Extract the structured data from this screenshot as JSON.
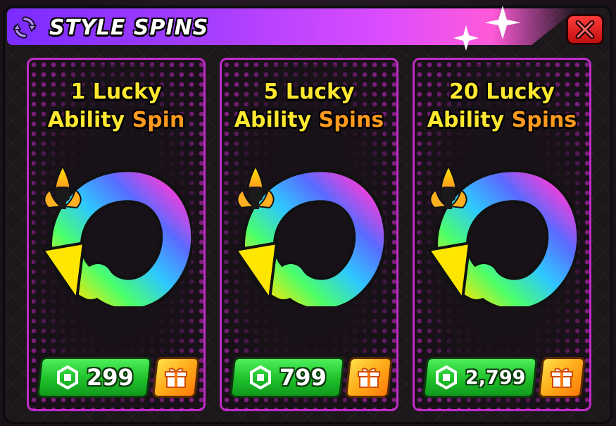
{
  "header": {
    "title": "STYLE SPINS",
    "refresh_icon": "refresh-icon",
    "close_icon": "close-icon"
  },
  "colors": {
    "header_start": "#7b2cff",
    "header_end": "#ff5ad8",
    "card_border": "#c02cc8",
    "price_green": "#1fbf2a",
    "gift_orange": "#ffab1a",
    "title_yellow": "#ffe830",
    "title_orange": "#ff9a1e",
    "close_red": "#d41515"
  },
  "cards": [
    {
      "line1": "1 Lucky",
      "line2_a": "Ability ",
      "line2_b": "Spin",
      "price": "299",
      "currency_icon": "robux-icon",
      "gift_icon": "gift-icon"
    },
    {
      "line1": "5 Lucky",
      "line2_a": "Ability ",
      "line2_b": "Spins",
      "price": "799",
      "currency_icon": "robux-icon",
      "gift_icon": "gift-icon"
    },
    {
      "line1": "20 Lucky",
      "line2_a": "Ability ",
      "line2_b": "Spins",
      "price": "2,799",
      "currency_icon": "robux-icon",
      "gift_icon": "gift-icon"
    }
  ]
}
